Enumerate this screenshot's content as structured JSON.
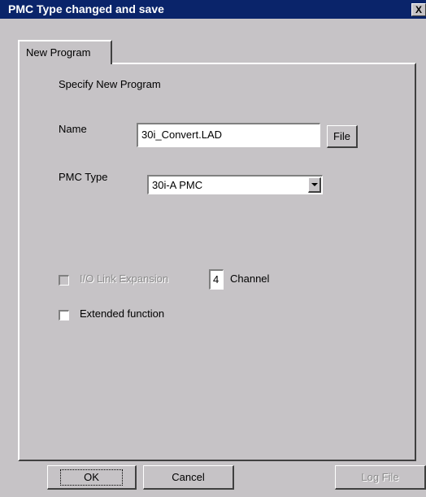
{
  "window": {
    "title": "PMC Type changed and save",
    "close_label": "X"
  },
  "tab": {
    "label": "New Program"
  },
  "form": {
    "heading": "Specify New Program",
    "name_label": "Name",
    "name_value": "30i_Convert.LAD",
    "file_button": "File",
    "pmc_type_label": "PMC Type",
    "pmc_type_value": "30i-A PMC",
    "io_link_label": "I/O Link Expansion",
    "channel_value": "4",
    "channel_label": "Channel",
    "extended_label": "Extended function"
  },
  "footer": {
    "ok": "OK",
    "cancel": "Cancel",
    "log_file": "Log File"
  }
}
